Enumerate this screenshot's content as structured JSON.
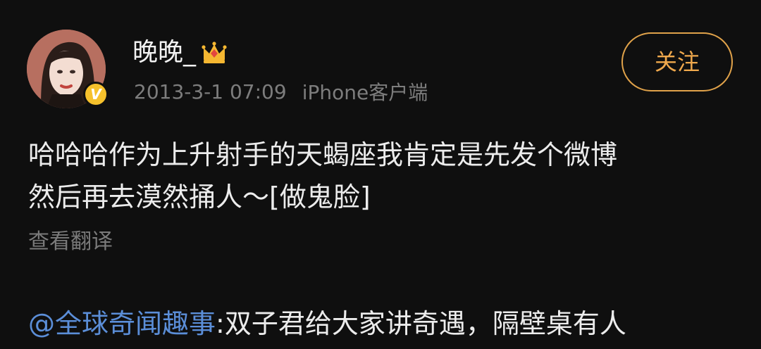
{
  "post": {
    "username": "晚晚_",
    "timestamp": "2013-3-1 07:09",
    "source": "iPhone客户端",
    "follow_label": "关注",
    "verified_mark": "V",
    "body_lines": [
      "哈哈哈作为上升射手的天蝎座我肯定是先发个微博",
      "然后再去漠然捅人～[做鬼脸]"
    ],
    "translate_label": "查看翻译"
  },
  "repost": {
    "mention": "@全球奇闻趣事",
    "text": ":双子君给大家讲奇遇，隔壁桌有人"
  },
  "colors": {
    "background": "#0f0f0f",
    "follow_accent": "#f0a94d",
    "mention_link": "#5b8ed8",
    "verified_badge": "#f6c12c",
    "meta_text": "#7d7d7d"
  }
}
